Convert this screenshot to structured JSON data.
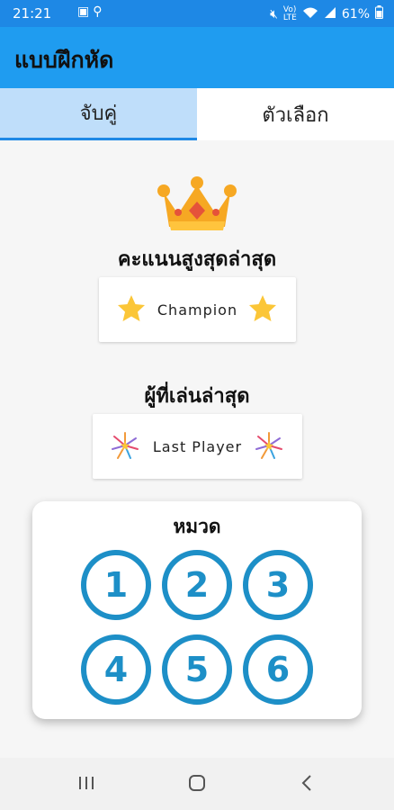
{
  "status_bar": {
    "time": "21:21",
    "battery": "61%",
    "icons": [
      "image-icon",
      "usb-icon",
      "mute-icon",
      "volte-icon",
      "wifi-icon",
      "signal-icon",
      "battery-icon"
    ]
  },
  "app_bar": {
    "title": "แบบฝึกหัด"
  },
  "tabs": [
    {
      "label": "จับคู่",
      "active": true
    },
    {
      "label": "ตัวเลือก",
      "active": false
    }
  ],
  "high_score": {
    "heading": "คะแนนสูงสุดล่าสุด",
    "value": "Champion"
  },
  "last_player": {
    "heading": "ผู้ที่เล่นล่าสุด",
    "value": "Last Player"
  },
  "category": {
    "title": "หมวด",
    "items": [
      "1",
      "2",
      "3",
      "4",
      "5",
      "6"
    ]
  },
  "nav": [
    "recent-apps",
    "home",
    "back"
  ],
  "colors": {
    "status_bar": "#1e88e5",
    "app_bar": "#1f9cf0",
    "active_tab": "#bfdefa",
    "accent": "#1d8fc7"
  }
}
